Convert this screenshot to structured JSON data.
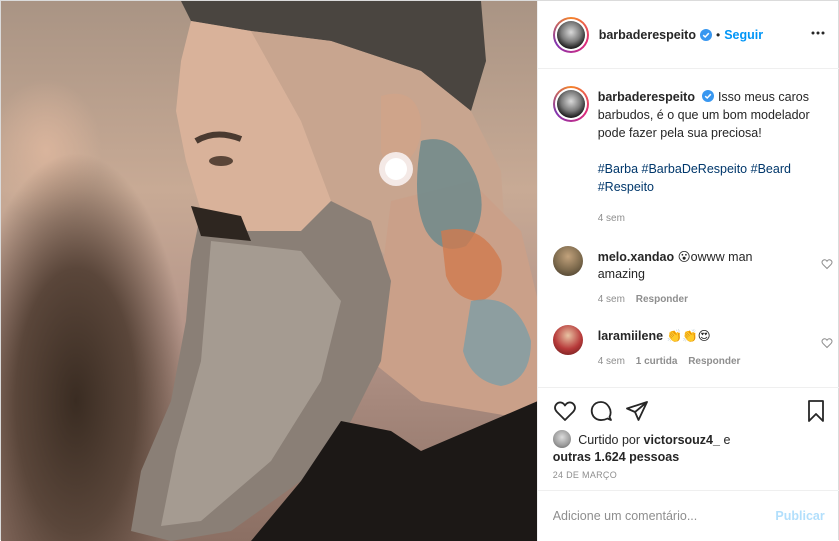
{
  "header": {
    "username": "barbaderespeito",
    "separator": "•",
    "follow_label": "Seguir"
  },
  "caption": {
    "username": "barbaderespeito",
    "text": "Isso meus caros barbudos, é o que um bom modelador pode fazer pela sua preciosa!",
    "hashtags": [
      "#Barba",
      "#BarbaDeRespeito",
      "#Beard",
      "#Respeito"
    ],
    "time": "4 sem"
  },
  "comments": [
    {
      "username": "melo.xandao",
      "text": "😮owww man amazing",
      "time": "4 sem",
      "reply_label": "Responder"
    },
    {
      "username": "laramiilene",
      "text": "👏👏😍",
      "time": "4 sem",
      "likes": "1 curtida",
      "reply_label": "Responder"
    }
  ],
  "likes": {
    "prefix": "Curtido por",
    "user": "victorsouz4_",
    "connector": "e",
    "others": "outras 1.624 pessoas"
  },
  "date": "24 DE MARÇO",
  "add_comment": {
    "placeholder": "Adicione um comentário...",
    "publish_label": "Publicar"
  },
  "colors": {
    "link": "#0095f6",
    "hashtag": "#00376b",
    "muted": "#8e8e8e",
    "publish_disabled": "#b2dffc"
  }
}
